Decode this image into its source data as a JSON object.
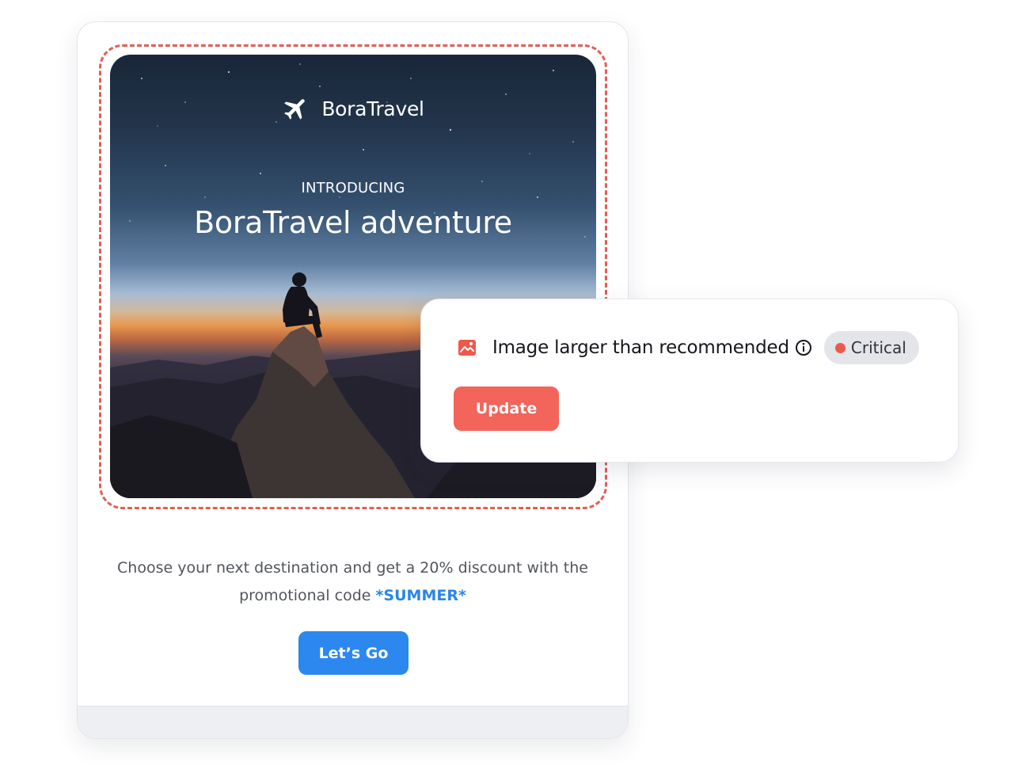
{
  "email": {
    "brand_name": "BoraTravel",
    "eyebrow": "INTRODUCING",
    "headline": "BoraTravel adventure",
    "promo_text": "Choose your next destination and get a 20% discount with the promotional code ",
    "promo_code": "*SUMMER*",
    "cta_label": "Let’s Go"
  },
  "alert": {
    "icon": "image-warning-icon",
    "title": "Image larger than recommended",
    "info_icon": "info-icon",
    "severity_label": "Critical",
    "update_label": "Update"
  },
  "colors": {
    "accent_blue": "#2c88ee",
    "alert_red": "#f3645a",
    "dashed_outline": "#e25f55",
    "badge_bg": "#e3e5e9"
  }
}
